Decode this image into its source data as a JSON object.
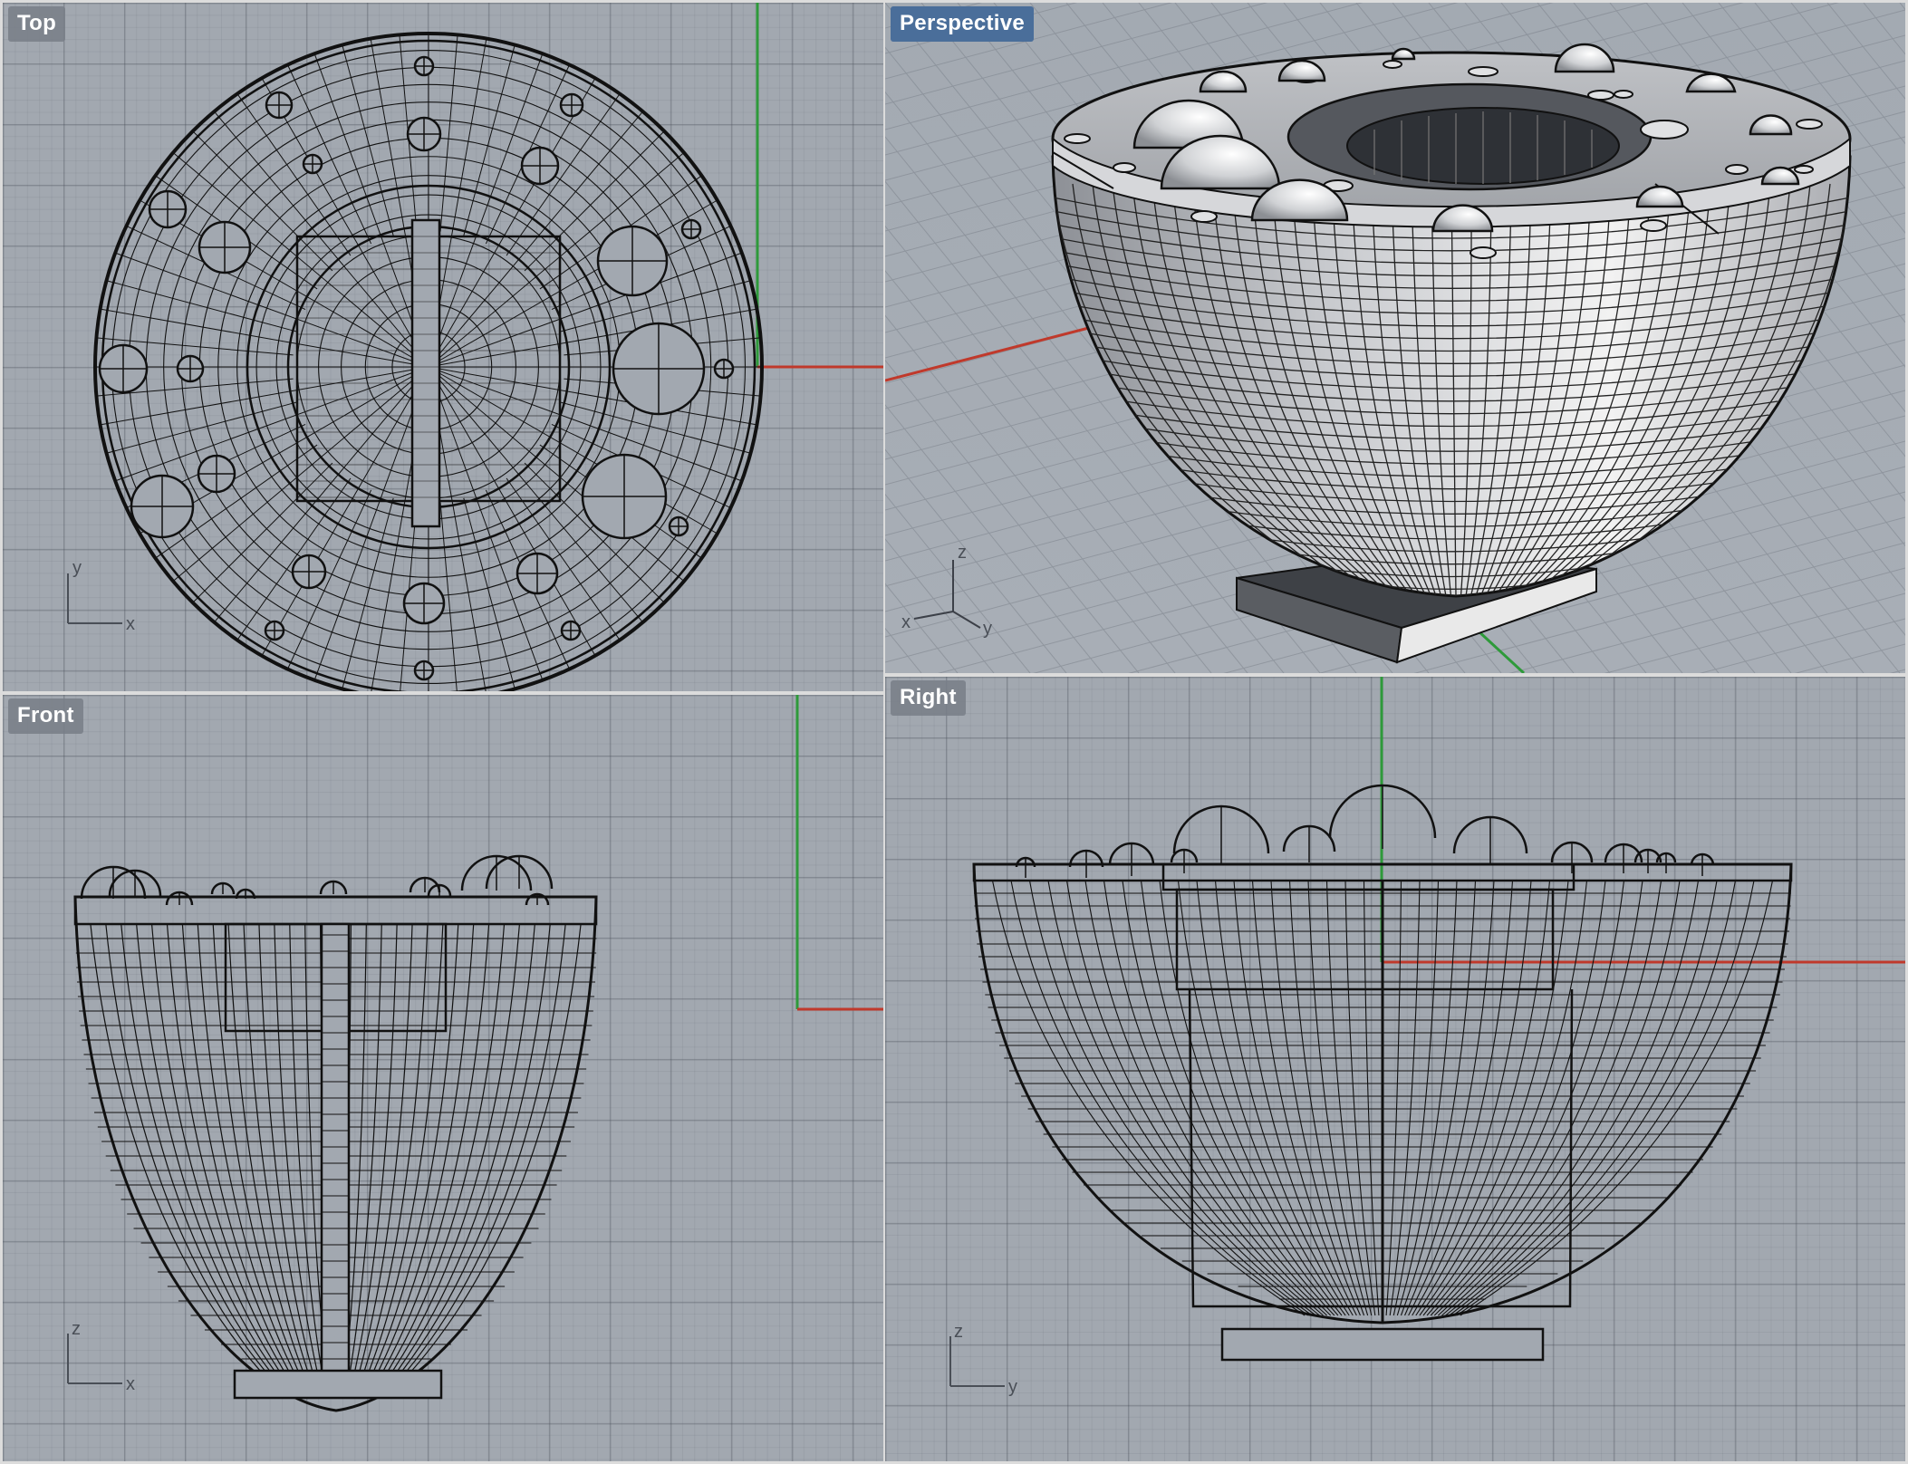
{
  "viewports": {
    "top": {
      "label": "Top",
      "axis_h": "x",
      "axis_v": "y"
    },
    "persp": {
      "label": "Perspective",
      "axis_x": "x",
      "axis_y": "y",
      "axis_z": "z"
    },
    "front": {
      "label": "Front",
      "axis_h": "x",
      "axis_v": "z"
    },
    "right": {
      "label": "Right",
      "axis_h": "y",
      "axis_v": "z"
    }
  },
  "colors": {
    "grid_bg": "#a2a8b0",
    "world_x_axis": "#c0392b",
    "world_y_axis": "#2e9a3a",
    "active_label": "#4a6e9a",
    "wire": "#111111"
  },
  "active_viewport": "Perspective"
}
